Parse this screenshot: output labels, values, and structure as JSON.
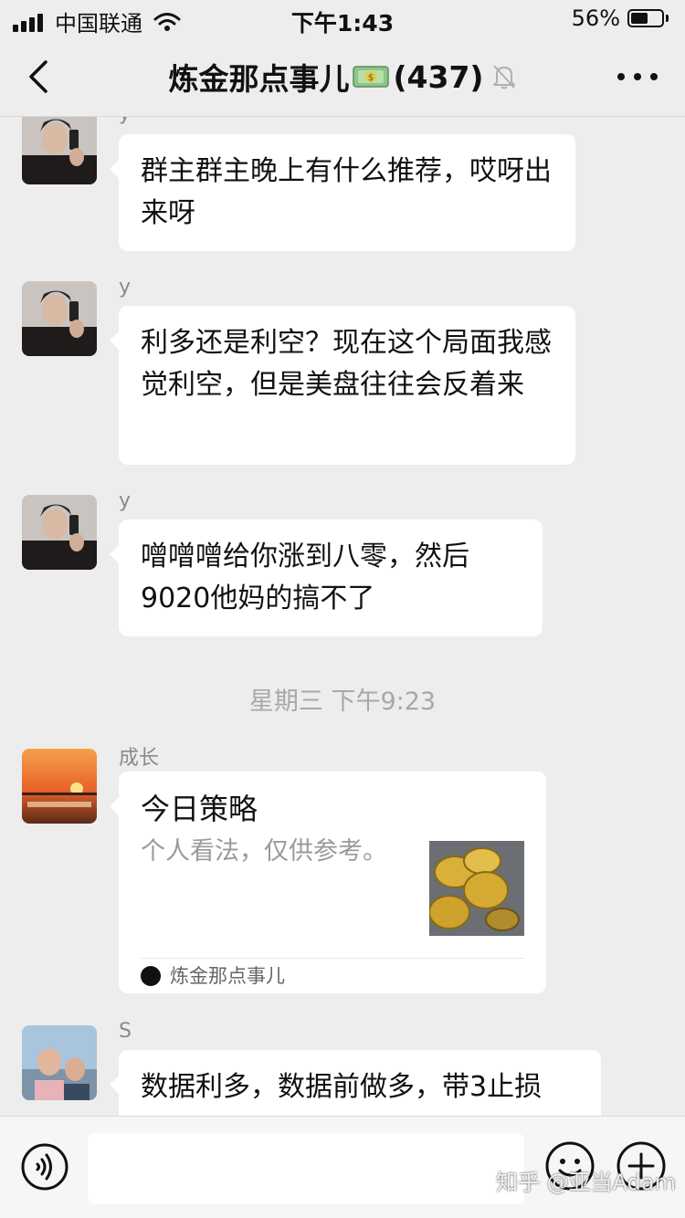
{
  "status_bar": {
    "carrier": "中国联通",
    "time": "下午1:43",
    "battery": "56%",
    "battery_level": 0.56
  },
  "nav": {
    "title": "炼金那点事儿",
    "member_count": "(437)"
  },
  "messages": [
    {
      "sender": "y",
      "text": "群主群主晚上有什么推荐，哎呀出来呀"
    },
    {
      "sender": "y",
      "text": "利多还是利空？现在这个局面我感觉利空，但是美盘往往会反着来"
    },
    {
      "sender": "y",
      "text": "噌噌噌给你涨到八零，然后9020他妈的搞不了"
    }
  ],
  "time_divider": "星期三 下午9:23",
  "card_message": {
    "sender": "成长",
    "title": "今日策略",
    "description": "个人看法，仅供参考。",
    "source": "炼金那点事儿"
  },
  "last_message": {
    "sender": "S",
    "text": "数据利多，数据前做多，带3止损"
  },
  "input_bar": {
    "placeholder": "",
    "watermark": "知乎 @亚当Adam"
  }
}
